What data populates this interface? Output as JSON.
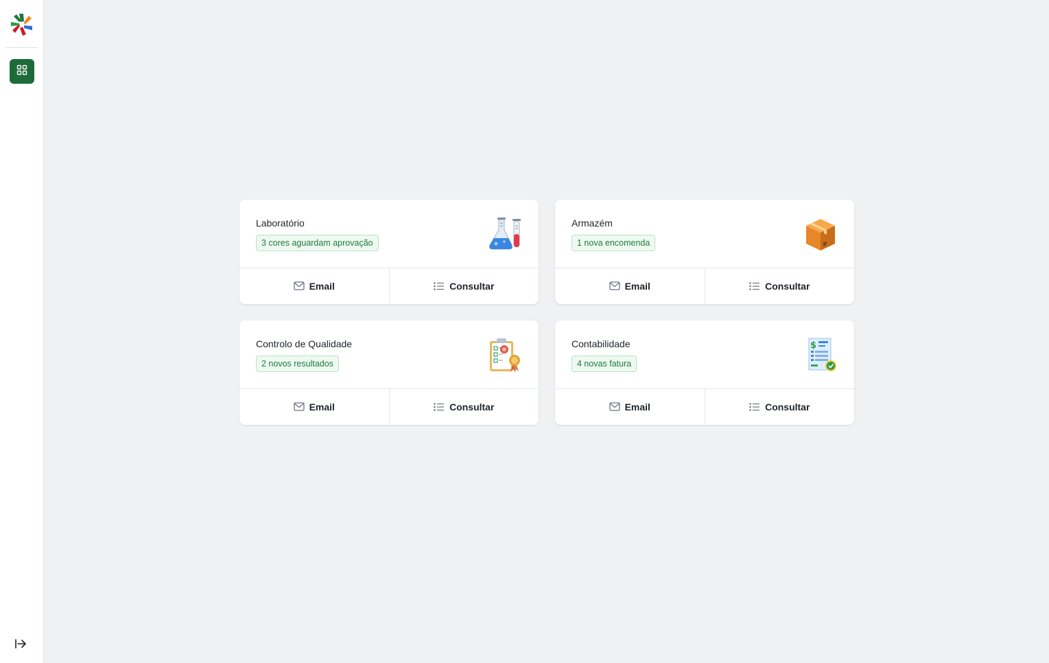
{
  "sidebar": {
    "logo_icon": "company-logo",
    "nav_icon": "grid-icon",
    "logout_icon": "logout-arrow-icon",
    "accent": "#1e6b3a"
  },
  "cards": [
    {
      "title": "Laboratório",
      "badge": "3 cores aguardam aprovação",
      "icon": "lab-flask-icon",
      "email_label": "Email",
      "consult_label": "Consultar"
    },
    {
      "title": "Armazém",
      "badge": "1 nova encomenda",
      "icon": "package-box-icon",
      "email_label": "Email",
      "consult_label": "Consultar"
    },
    {
      "title": "Controlo de Qualidade",
      "badge": "2 novos resultados",
      "icon": "quality-clipboard-icon",
      "email_label": "Email",
      "consult_label": "Consultar"
    },
    {
      "title": "Contabilidade",
      "badge": "4 novas fatura",
      "icon": "invoice-icon",
      "email_label": "Email",
      "consult_label": "Consultar"
    }
  ],
  "colors": {
    "badge_text": "#1f7a3d",
    "badge_bg": "#eefaf1",
    "badge_border": "#b9e3c5",
    "page_bg": "#f0f1f3"
  }
}
